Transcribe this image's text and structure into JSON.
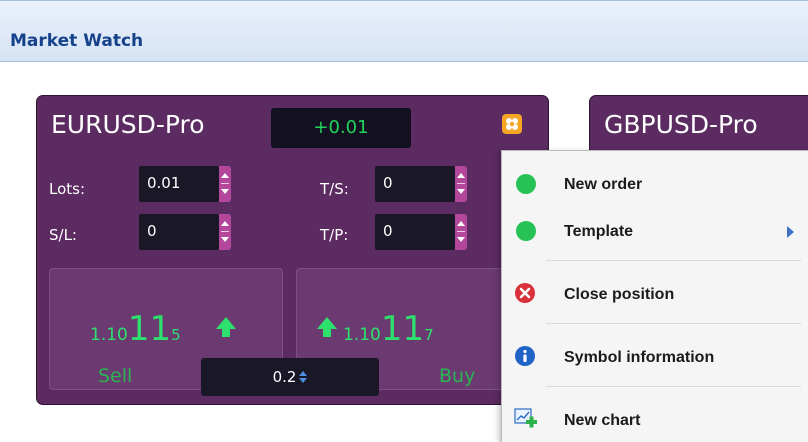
{
  "panel": {
    "title": "Market Watch"
  },
  "cards": [
    {
      "symbol": "EURUSD-Pro",
      "change": "+0.01",
      "fields": {
        "lots_label": "Lots:",
        "lots_value": "0.01",
        "sl_label": "S/L:",
        "sl_value": "0",
        "ts_label": "T/S:",
        "ts_value": "0",
        "tp_label": "T/P:",
        "tp_value": "0"
      },
      "sell": {
        "price_prefix": "1.10",
        "price_big": "11",
        "price_sup": "5",
        "label": "Sell"
      },
      "buy": {
        "price_prefix": "1.10",
        "price_big": "11",
        "price_sup": "7",
        "label": "Buy"
      },
      "spread": "0.2"
    },
    {
      "symbol": "GBPUSD-Pro"
    }
  ],
  "context_menu": {
    "items": [
      {
        "label": "New order",
        "icon": "green-dot-icon"
      },
      {
        "label": "Template",
        "icon": "green-dot-icon",
        "has_submenu": true
      },
      {
        "label": "Close position",
        "icon": "close-circle-icon"
      },
      {
        "label": "Symbol information",
        "icon": "info-icon"
      },
      {
        "label": "New chart",
        "icon": "new-chart-icon"
      }
    ]
  },
  "colors": {
    "card_bg": "#5b2b62",
    "accent_green": "#2ee06c",
    "spin_pink": "#b2479b",
    "header_text": "#15428b",
    "settings_orange": "#f5a623"
  }
}
